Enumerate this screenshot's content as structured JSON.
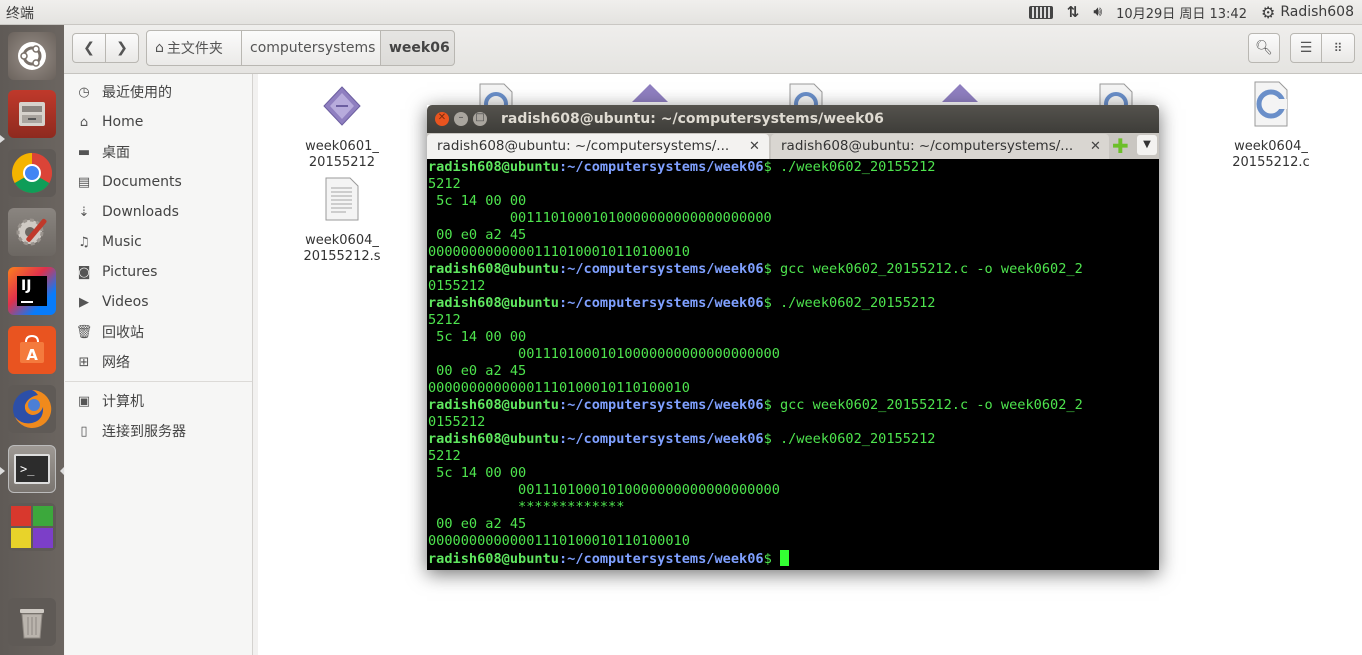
{
  "top_panel": {
    "title": "终端",
    "datetime": "10月29日 周日 13:42",
    "user": "Radish608"
  },
  "launcher": {
    "items": [
      "ubuntu-dash",
      "files",
      "chrome",
      "system-settings",
      "intellij",
      "software-center",
      "firefox",
      "terminal",
      "workspaces",
      "trash"
    ]
  },
  "nautilus": {
    "breadcrumbs": [
      "主文件夹",
      "computersystems",
      "week06"
    ],
    "sidebar": [
      {
        "label": "最近使用的",
        "icon": "clock-icon"
      },
      {
        "label": "Home",
        "icon": "home-icon"
      },
      {
        "label": "桌面",
        "icon": "folder-icon"
      },
      {
        "label": "Documents",
        "icon": "document-icon"
      },
      {
        "label": "Downloads",
        "icon": "download-icon"
      },
      {
        "label": "Music",
        "icon": "music-icon"
      },
      {
        "label": "Pictures",
        "icon": "camera-icon"
      },
      {
        "label": "Videos",
        "icon": "video-icon"
      },
      {
        "label": "回收站",
        "icon": "trash-icon"
      },
      {
        "label": "网络",
        "icon": "network-icon"
      },
      {
        "label": "计算机",
        "icon": "computer-icon"
      },
      {
        "label": "连接到服务器",
        "icon": "server-icon"
      }
    ],
    "files": [
      {
        "name_line1": "week0601_",
        "name_line2": "20155212",
        "type": "executable"
      },
      {
        "name_line1": "week0604_",
        "name_line2": "20155212.s",
        "type": "text"
      },
      {
        "name_line1": "week0604_",
        "name_line2": "20155212.c",
        "type": "c-source"
      }
    ]
  },
  "terminal": {
    "title": "radish608@ubuntu: ~/computersystems/week06",
    "tabs": [
      {
        "label": "radish608@ubuntu: ~/computersystems/...",
        "active": true
      },
      {
        "label": "radish608@ubuntu: ~/computersystems/...",
        "active": false
      }
    ],
    "prompt_user": "radish608@ubuntu",
    "prompt_path": ":~/computersystems/week06",
    "prompt_symbol": "$ ",
    "lines": [
      {
        "type": "prompt",
        "cmd": "./week0602_20155212"
      },
      {
        "type": "out",
        "text": "5212"
      },
      {
        "type": "out",
        "text": " 5c 14 00 00"
      },
      {
        "type": "out",
        "text": "          00111010001010000000000000000000"
      },
      {
        "type": "out",
        "text": " 00 e0 a2 45"
      },
      {
        "type": "out",
        "text": "00000000000001110100010110100010"
      },
      {
        "type": "prompt",
        "cmd": "gcc week0602_20155212.c -o week0602_2"
      },
      {
        "type": "out",
        "text": "0155212"
      },
      {
        "type": "prompt",
        "cmd": "./week0602_20155212"
      },
      {
        "type": "out",
        "text": "5212"
      },
      {
        "type": "out",
        "text": " 5c 14 00 00"
      },
      {
        "type": "out",
        "text": "           00111010001010000000000000000000"
      },
      {
        "type": "out",
        "text": " 00 e0 a2 45"
      },
      {
        "type": "out",
        "text": "00000000000001110100010110100010"
      },
      {
        "type": "prompt",
        "cmd": "gcc week0602_20155212.c -o week0602_2"
      },
      {
        "type": "out",
        "text": "0155212"
      },
      {
        "type": "prompt",
        "cmd": "./week0602_20155212"
      },
      {
        "type": "out",
        "text": "5212"
      },
      {
        "type": "out",
        "text": " 5c 14 00 00"
      },
      {
        "type": "out",
        "text": "           00111010001010000000000000000000"
      },
      {
        "type": "out",
        "text": "           *************"
      },
      {
        "type": "out",
        "text": " 00 e0 a2 45"
      },
      {
        "type": "out",
        "text": "00000000000001110100010110100010"
      },
      {
        "type": "prompt-cursor",
        "cmd": ""
      }
    ]
  }
}
